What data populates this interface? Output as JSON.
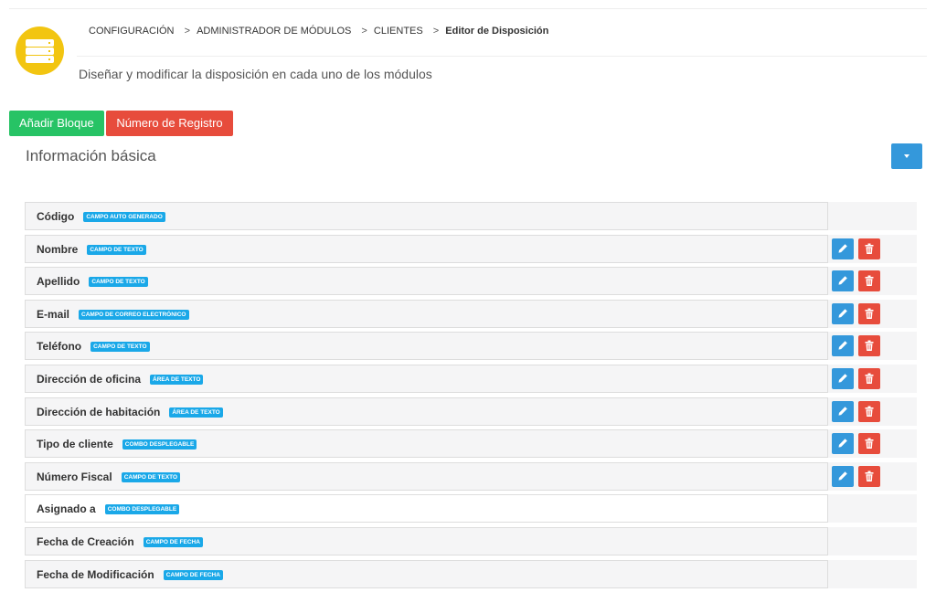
{
  "breadcrumb": {
    "items": [
      "CONFIGURACIÓN",
      "ADMINISTRADOR DE MÓDULOS",
      "CLIENTES",
      "Editor de Disposición"
    ],
    "separator": ">"
  },
  "header": {
    "subtitle": "Diseñar y modificar la disposición en cada uno de los módulos",
    "icon": "server-icon"
  },
  "toolbar": {
    "add_block_label": "Añadir Bloque",
    "record_number_label": "Número de Registro"
  },
  "block": {
    "title": "Información básica",
    "fields": [
      {
        "label": "Código",
        "tag": "CAMPO AUTO GENERADO",
        "editable": false
      },
      {
        "label": "Nombre",
        "tag": "CAMPO DE TEXTO",
        "editable": true
      },
      {
        "label": "Apellido",
        "tag": "CAMPO DE TEXTO",
        "editable": true
      },
      {
        "label": "E-mail",
        "tag": "CAMPO DE CORREO ELECTRÓNICO",
        "editable": true
      },
      {
        "label": "Teléfono",
        "tag": "CAMPO DE TEXTO",
        "editable": true
      },
      {
        "label": "Dirección de oficina",
        "tag": "ÁREA DE TEXTO",
        "editable": true
      },
      {
        "label": "Dirección de habitación",
        "tag": "ÁREA DE TEXTO",
        "editable": true
      },
      {
        "label": "Tipo de cliente",
        "tag": "COMBO DESPLEGABLE",
        "editable": true
      },
      {
        "label": "Número Fiscal",
        "tag": "CAMPO DE TEXTO",
        "editable": true
      },
      {
        "label": "Asignado a",
        "tag": "COMBO DESPLEGABLE",
        "editable": false
      },
      {
        "label": "Fecha de Creación",
        "tag": "CAMPO DE FECHA",
        "editable": false
      },
      {
        "label": "Fecha de Modificación",
        "tag": "CAMPO DE FECHA",
        "editable": false
      }
    ]
  },
  "colors": {
    "primary": "#3498db",
    "success": "#27c365",
    "danger": "#e74c3c",
    "tag": "#1aa8e8",
    "module_icon": "#f2c511"
  }
}
